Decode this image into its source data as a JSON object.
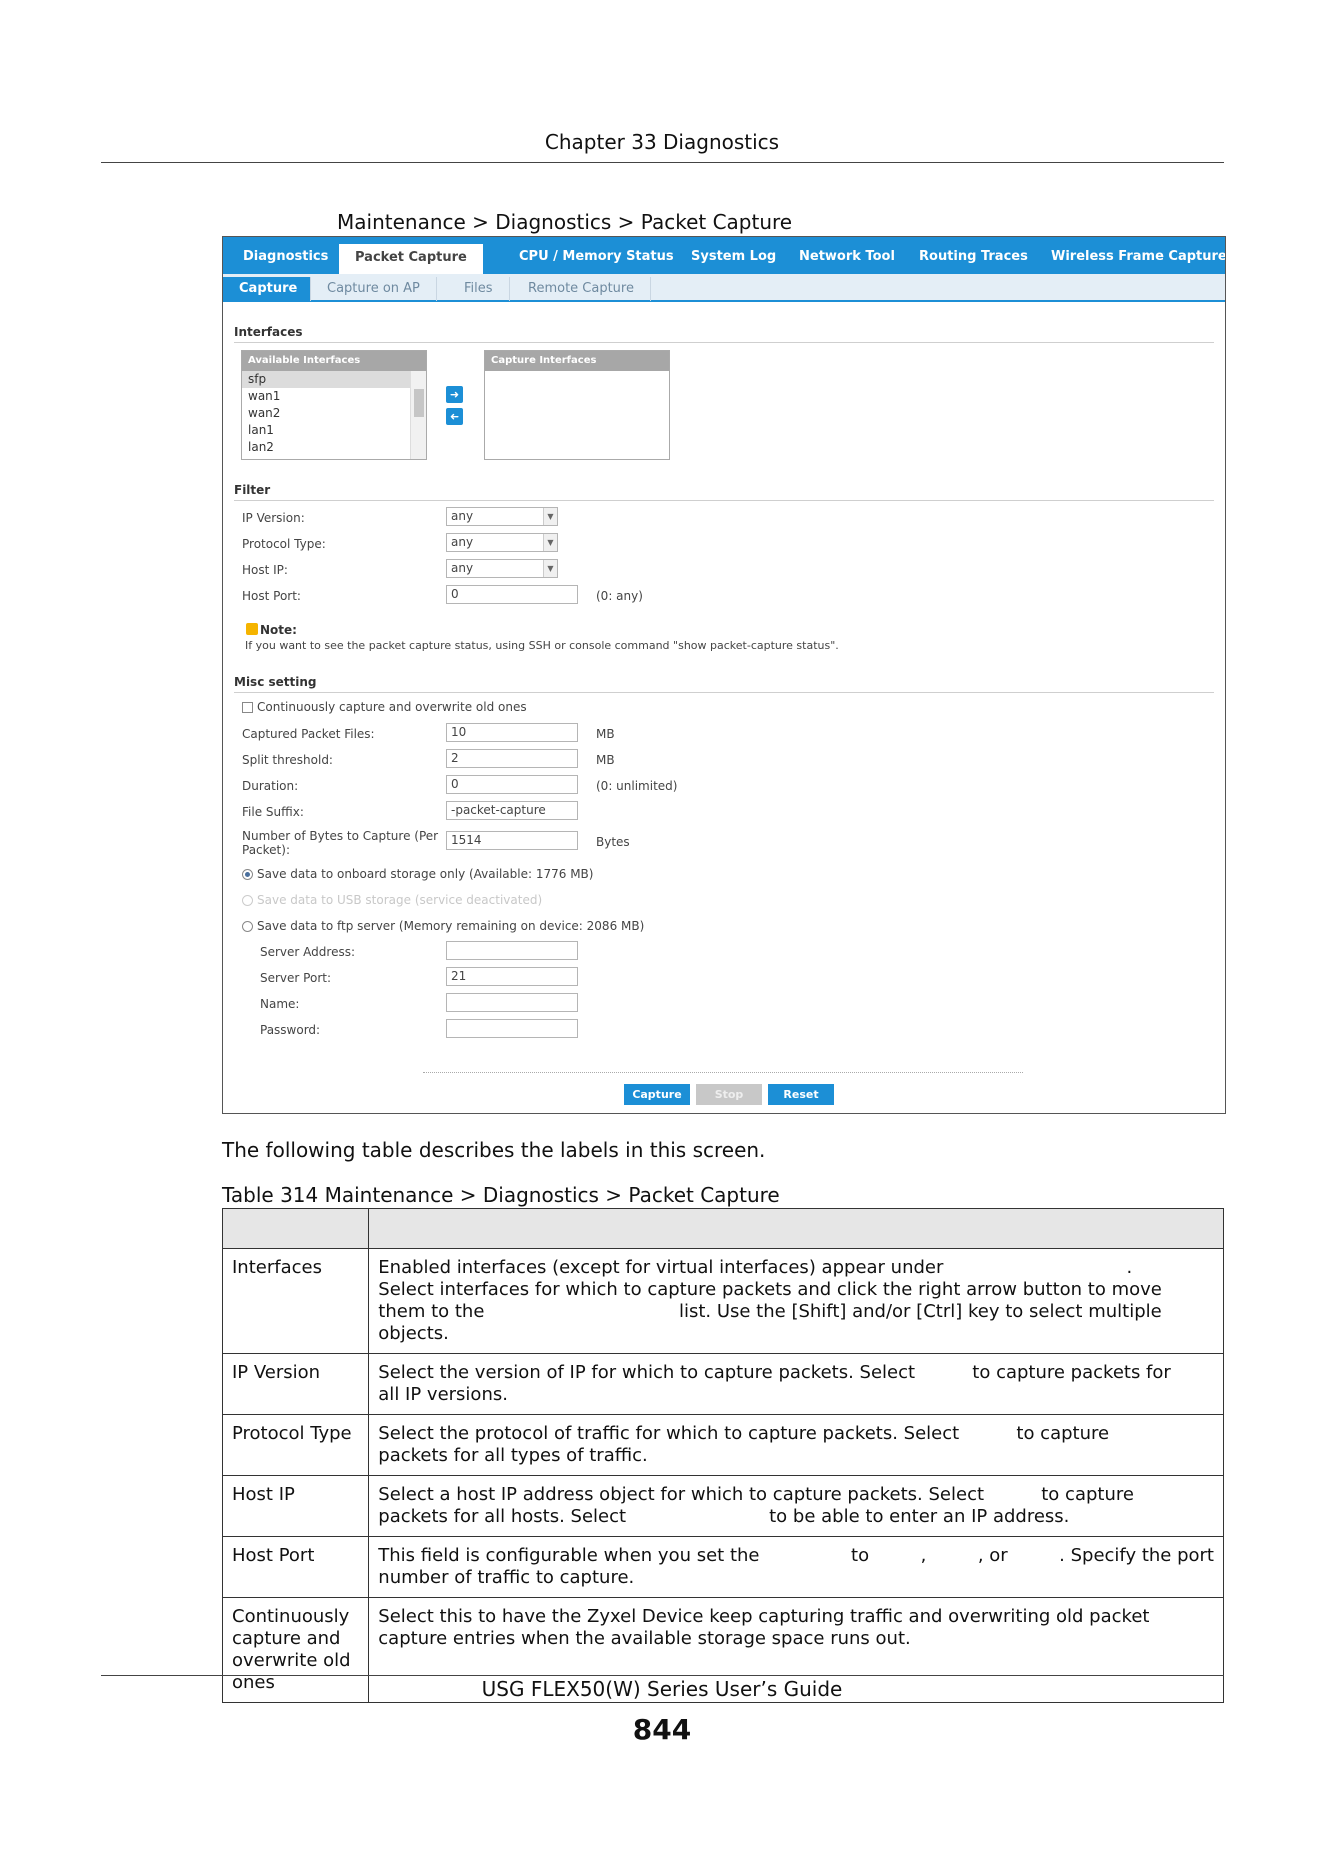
{
  "page": {
    "chapter_header": "Chapter 33 Diagnostics",
    "figure_caption": "Maintenance > Diagnostics > Packet Capture",
    "intro_text": "The following table describes the labels in this screen.",
    "table_caption": "Table 314   Maintenance > Diagnostics > Packet Capture",
    "footer_guide": "USG FLEX50(W) Series User’s Guide",
    "page_number": "844"
  },
  "ui": {
    "tabs": [
      "Diagnostics",
      "Packet Capture",
      "CPU / Memory Status",
      "System Log",
      "Network Tool",
      "Routing Traces",
      "Wireless Frame Capture"
    ],
    "subtabs": [
      "Capture",
      "Capture on AP",
      "Files",
      "Remote Capture"
    ],
    "interfaces": {
      "section_title": "Interfaces",
      "available_header": "Available Interfaces",
      "capture_header": "Capture Interfaces",
      "available_items": [
        "sfp",
        "wan1",
        "wan2",
        "lan1",
        "lan2"
      ],
      "move_right_icon": "arrow-right-icon",
      "move_left_icon": "arrow-left-icon"
    },
    "filter": {
      "section_title": "Filter",
      "ip_version_label": "IP Version:",
      "ip_version_value": "any",
      "protocol_type_label": "Protocol Type:",
      "protocol_type_value": "any",
      "host_ip_label": "Host IP:",
      "host_ip_value": "any",
      "host_port_label": "Host Port:",
      "host_port_value": "0",
      "host_port_hint": "(0: any)",
      "note_title": "Note:",
      "note_text": "If you want to see the packet capture status, using SSH or console command \"show packet-capture status\"."
    },
    "misc": {
      "section_title": "Misc setting",
      "continuous_label": "Continuously capture and overwrite old ones",
      "captured_files_label": "Captured Packet Files:",
      "captured_files_value": "10",
      "captured_files_unit": "MB",
      "split_label": "Split threshold:",
      "split_value": "2",
      "split_unit": "MB",
      "duration_label": "Duration:",
      "duration_value": "0",
      "duration_hint": "(0: unlimited)",
      "suffix_label": "File Suffix:",
      "suffix_value": "-packet-capture",
      "bytes_label_1": "Number of Bytes to Capture (Per",
      "bytes_label_2": "Packet):",
      "bytes_value": "1514",
      "bytes_unit": "Bytes",
      "onboard_label": "Save data to onboard storage only (Available: 1776 MB)",
      "usb_label": "Save data to USB storage (service deactivated)",
      "ftp_label": "Save data to ftp server (Memory remaining on device: 2086 MB)",
      "server_address_label": "Server Address:",
      "server_address_value": "",
      "server_port_label": "Server Port:",
      "server_port_value": "21",
      "name_label": "Name:",
      "name_value": "",
      "password_label": "Password:",
      "password_value": ""
    },
    "buttons": {
      "capture": "Capture",
      "stop": "Stop",
      "reset": "Reset"
    },
    "colors": {
      "accent": "#1c8fd6",
      "header_gray": "#a7a7a7",
      "note_icon": "#f5b400"
    }
  },
  "table": {
    "headers": [
      "",
      ""
    ],
    "rows": [
      {
        "label": "Interfaces",
        "desc": [
          "Enabled interfaces (except for virtual interfaces) appear under                                .",
          "Select interfaces for which to capture packets and click the right arrow button to move",
          "them to the                                  list. Use the [Shift] and/or [Ctrl] key to select multiple",
          "objects."
        ]
      },
      {
        "label": "IP Version",
        "desc": [
          "Select the version of IP for which to capture packets. Select          to capture packets for",
          "all IP versions."
        ]
      },
      {
        "label": "Protocol Type",
        "desc": [
          "Select the protocol of traffic for which to capture packets. Select          to capture",
          "packets for all types of traffic."
        ]
      },
      {
        "label": "Host IP",
        "desc": [
          "Select a host IP address object for which to capture packets. Select          to capture",
          "packets for all hosts. Select                         to be able to enter an IP address."
        ]
      },
      {
        "label": "Host Port",
        "desc": [
          "This field is configurable when you set the                to         ,         , or         . Specify the port",
          "number of traffic to capture."
        ]
      },
      {
        "label": "Continuously capture and overwrite old ones",
        "desc": [
          "Select this to have the Zyxel Device keep capturing traffic and overwriting old packet",
          "capture entries when the available storage space runs out."
        ]
      }
    ]
  }
}
